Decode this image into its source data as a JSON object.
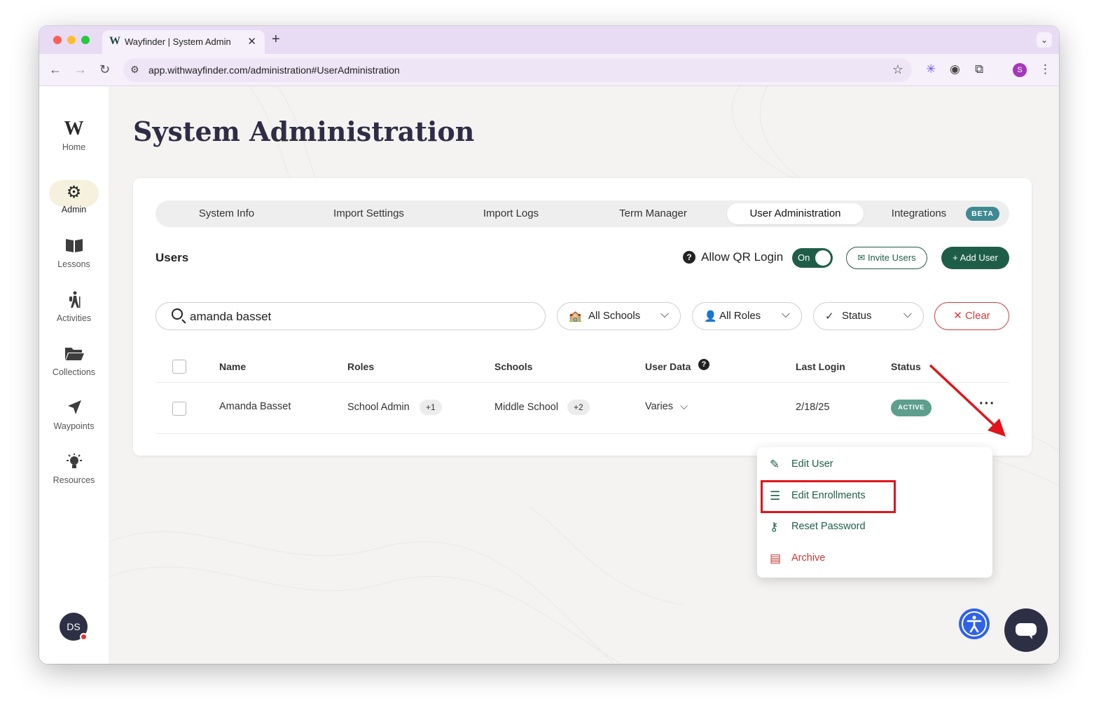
{
  "browser": {
    "tab_title": "Wayfinder | System Admin",
    "tab_favicon": "W",
    "url": "app.withwayfinder.com/administration#UserAdministration",
    "profile_initial": "S"
  },
  "sidebar": {
    "logo_letter": "W",
    "items": [
      {
        "label": "Home",
        "icon": "wayfinder-logo-icon"
      },
      {
        "label": "Admin",
        "icon": "gear-icon"
      },
      {
        "label": "Lessons",
        "icon": "book-icon"
      },
      {
        "label": "Activities",
        "icon": "hiker-icon"
      },
      {
        "label": "Collections",
        "icon": "folder-icon"
      },
      {
        "label": "Waypoints",
        "icon": "navigation-arrow-icon"
      },
      {
        "label": "Resources",
        "icon": "lightbulb-icon"
      }
    ],
    "avatar_initials": "DS"
  },
  "page": {
    "title": "System Administration"
  },
  "tabs": [
    {
      "label": "System Info"
    },
    {
      "label": "Import Settings"
    },
    {
      "label": "Import Logs"
    },
    {
      "label": "Term Manager"
    },
    {
      "label": "User Administration",
      "active": true
    },
    {
      "label": "Integrations",
      "badge": "BETA"
    }
  ],
  "users": {
    "title": "Users",
    "qr_login_label": "Allow QR Login",
    "qr_toggle": "On",
    "invite_label": "Invite Users",
    "add_label": "Add User"
  },
  "filters": {
    "search_value": "amanda basset",
    "schools": "All Schools",
    "roles": "All Roles",
    "status": "Status",
    "clear": "Clear"
  },
  "table": {
    "columns": [
      "Name",
      "Roles",
      "Schools",
      "User Data",
      "Last Login",
      "Status"
    ],
    "rows": [
      {
        "name": "Amanda Basset",
        "role": "School Admin",
        "role_extra": "+1",
        "school": "Middle School",
        "school_extra": "+2",
        "user_data": "Varies",
        "last_login": "2/18/25",
        "status": "ACTIVE"
      }
    ]
  },
  "menu": {
    "items": [
      {
        "label": "Edit User",
        "icon": "pencil-icon"
      },
      {
        "label": "Edit Enrollments",
        "icon": "list-icon"
      },
      {
        "label": "Reset Password",
        "icon": "key-icon"
      },
      {
        "label": "Archive",
        "icon": "archive-box-icon"
      }
    ]
  },
  "colors": {
    "brand_green": "#1e5e49",
    "danger": "#d23b3b",
    "active_badge": "#5e9e8c",
    "beta_badge": "#3f8a92",
    "annotation_red": "#e1141b"
  }
}
